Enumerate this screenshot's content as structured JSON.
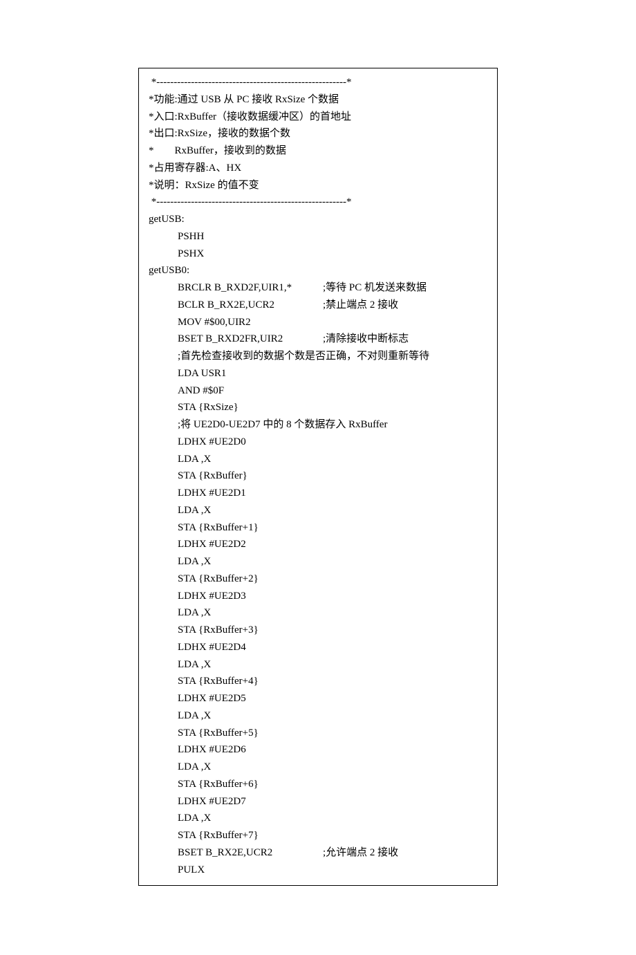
{
  "code": {
    "hr": " *-------------------------------------------------------*",
    "c1": "*功能:通过 USB 从 PC 接收 RxSize 个数据",
    "c2": "*入口:RxBuffer（接收数据缓冲区）的首地址",
    "c3": "*出口:RxSize，接收的数据个数",
    "c4": "*        RxBuffer，接收到的数据",
    "c5": "*占用寄存器:A、HX",
    "c6": "*说明：RxSize 的值不变",
    "lbl1": "getUSB:",
    "l1": "PSHH",
    "l2": "PSHX",
    "lbl2": "getUSB0:",
    "l3": "BRCLR B_RXD2F,UIR1,*",
    "l3c": ";等待 PC 机发送来数据",
    "l4": "BCLR B_RX2E,UCR2",
    "l4c": ";禁止端点 2 接收",
    "l5": "MOV #$00,UIR2",
    "l6": "BSET B_RXD2FR,UIR2",
    "l6c": ";清除接收中断标志",
    "l7": ";首先检查接收到的数据个数是否正确，不对则重新等待",
    "l8": "LDA USR1",
    "l9": "AND #$0F",
    "l10": "STA {RxSize}",
    "l11": ";将 UE2D0-UE2D7 中的 8 个数据存入 RxBuffer",
    "l12": "LDHX #UE2D0",
    "l13": "LDA ,X",
    "l14": "STA {RxBuffer}",
    "l15": "LDHX #UE2D1",
    "l16": "LDA ,X",
    "l17": "STA {RxBuffer+1}",
    "l18": "LDHX #UE2D2",
    "l19": "LDA ,X",
    "l20": "STA {RxBuffer+2}",
    "l21": "LDHX #UE2D3",
    "l22": "LDA ,X",
    "l23": "STA {RxBuffer+3}",
    "l24": "LDHX #UE2D4",
    "l25": "LDA ,X",
    "l26": "STA {RxBuffer+4}",
    "l27": "LDHX #UE2D5",
    "l28": "LDA ,X",
    "l29": "STA {RxBuffer+5}",
    "l30": "LDHX #UE2D6",
    "l31": "LDA ,X",
    "l32": "STA {RxBuffer+6}",
    "l33": "LDHX #UE2D7",
    "l34": "LDA ,X",
    "l35": "STA {RxBuffer+7}",
    "l36": "BSET B_RX2E,UCR2",
    "l36c": ";允许端点 2 接收",
    "l37": "PULX"
  }
}
